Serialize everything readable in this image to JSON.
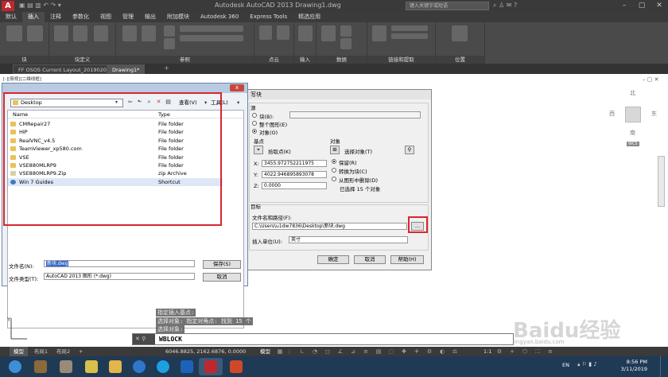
{
  "app": {
    "title": "Autodesk AutoCAD 2013  Drawing1.dwg",
    "search_placeholder": "键入关键字或短语"
  },
  "ribbon_tabs": [
    "默认",
    "插入",
    "注释",
    "参数化",
    "视图",
    "管理",
    "输出",
    "附加模块",
    "Autodesk 360",
    "Express Tools",
    "精选应用"
  ],
  "active_ribbon_tab": "插入",
  "ribbon_groups": [
    "块",
    "块定义",
    "参照",
    "点云",
    "输入",
    "数据",
    "链接和提取",
    "位置"
  ],
  "doc_tabs": [
    "FF OSOS Current Layout_20190201*",
    "Drawing1*"
  ],
  "active_doc_tab": "Drawing1*",
  "view_label": "[-][俯视][二维线框]",
  "view_cube": {
    "north": "北",
    "south": "南",
    "east": "东",
    "west": "西",
    "wcs": "WCS"
  },
  "file_dialog": {
    "look_in": "Desktop",
    "close_label": "x",
    "view_label": "查看(V)",
    "tools_label": "工具(L)",
    "columns": {
      "name": "Name",
      "type": "Type"
    },
    "files": [
      {
        "name": "CMRepair27",
        "type": "File folder",
        "kind": "folder"
      },
      {
        "name": "HIP",
        "type": "File folder",
        "kind": "folder"
      },
      {
        "name": "RealVNC_v4.5",
        "type": "File folder",
        "kind": "folder"
      },
      {
        "name": "TeamViewer_xp580.com",
        "type": "File folder",
        "kind": "folder"
      },
      {
        "name": "VSE",
        "type": "File folder",
        "kind": "folder"
      },
      {
        "name": "VSE880MLRP9",
        "type": "File folder",
        "kind": "folder"
      },
      {
        "name": "VSE880MLRP9.Zip",
        "type": "zip Archive",
        "kind": "zip"
      },
      {
        "name": "Win 7 Guides",
        "type": "Shortcut",
        "kind": "shortcut"
      }
    ],
    "filename_label": "文件名(N):",
    "filename_value": "新块.dwg",
    "filetype_label": "文件类型(T):",
    "filetype_value": "AutoCAD 2013 图形 (*.dwg)",
    "save_label": "保存(S)",
    "cancel_label": "取消"
  },
  "write_block": {
    "title": "写块",
    "source_label": "源",
    "block_label": "块(B):",
    "entire_drawing_label": "整个图形(E)",
    "objects_label": "对象(O)",
    "base_point_label": "基点",
    "pick_point_label": "拾取点(K)",
    "x_value": "3455.972752211975",
    "y_value": "4022.946895893078",
    "z_value": "0.0000",
    "objects_group_label": "对象",
    "select_objects_label": "选择对象(T)",
    "retain_label": "保留(R)",
    "convert_label": "转换为块(C)",
    "delete_label": "从图形中删除(D)",
    "selected_info": "已选择 15 个对象",
    "target_label": "目标",
    "path_label": "文件名和路径(F):",
    "path_value": "C:\\Users\\u1dw7836\\Desktop\\新块.dwg",
    "browse_label": "...",
    "units_label": "插入单位(U):",
    "units_value": "英寸",
    "ok_label": "确定",
    "cancel_label": "取消",
    "help_label": "帮助(H)"
  },
  "command_history": [
    "指定插入基点:",
    "选择对象: 指定对角点: 找到 15 个",
    "选择对象:"
  ],
  "command_input": "WBLOCK",
  "layout_tabs": [
    "模型",
    "布局1",
    "布局2"
  ],
  "active_layout_tab": "模型",
  "coords": "6046.8825, 2162.6876, 0.0000",
  "model_label": "模型",
  "scale_label": "1:1",
  "clock": {
    "time": "8:56 PM",
    "date": "3/11/2019"
  },
  "language": "EN",
  "watermark": "Baidu经验",
  "watermark_url": "jingyan.baidu.com",
  "colors": {
    "accent_red": "#d9262d",
    "ribbon": "#4a4a4a",
    "taskbar": "#1f3a55"
  }
}
